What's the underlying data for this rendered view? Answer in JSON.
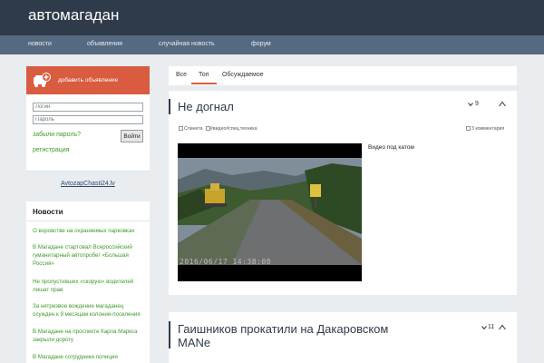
{
  "site": {
    "logo": "автомагадан"
  },
  "nav": {
    "items": [
      "новости",
      "объявления",
      "случайная новость",
      "форум"
    ]
  },
  "sidebar": {
    "ad_label": "добавить объявление",
    "login_placeholder": "Логин",
    "password_placeholder": "Пароль",
    "forgot_label": "забыли пароль?",
    "login_button": "Войти",
    "register_label": "регистрация",
    "partner_link": "AvtozapChasti24.lv",
    "news_title": "Новости",
    "news_items": [
      "О воровстве на охраняемых парковках",
      "В Магадане стартовал Всероссийский гуманитарный автопробег «Большая Россия»",
      "Не пропустивших «скорую» водителей лишат прав",
      "За нетрезвое вождение магаданец осужден к 9 месяцам колонии-поселения",
      "В Магадане на проспекте Карла Маркса закрыли дорогу",
      "В Магадане сотрудники полиции"
    ]
  },
  "tabs": {
    "items": [
      "Все",
      "Топ",
      "Обсуждаемое"
    ],
    "active": "Топ"
  },
  "posts": [
    {
      "title": "Не догнал",
      "votes": "9",
      "author": "Слинета",
      "tags": "#видео#спец.техника",
      "comments": "3 комментария",
      "caption": "Видео под катом",
      "video_timestamp": "2016/06/17 14:38:08"
    },
    {
      "title": "Гаишников прокатили на Дакаровском MANе",
      "votes": "11"
    }
  ],
  "colors": {
    "accent": "#d95b40",
    "header": "#2f3b4a",
    "nav": "#556980",
    "link": "#3f9a2a"
  }
}
